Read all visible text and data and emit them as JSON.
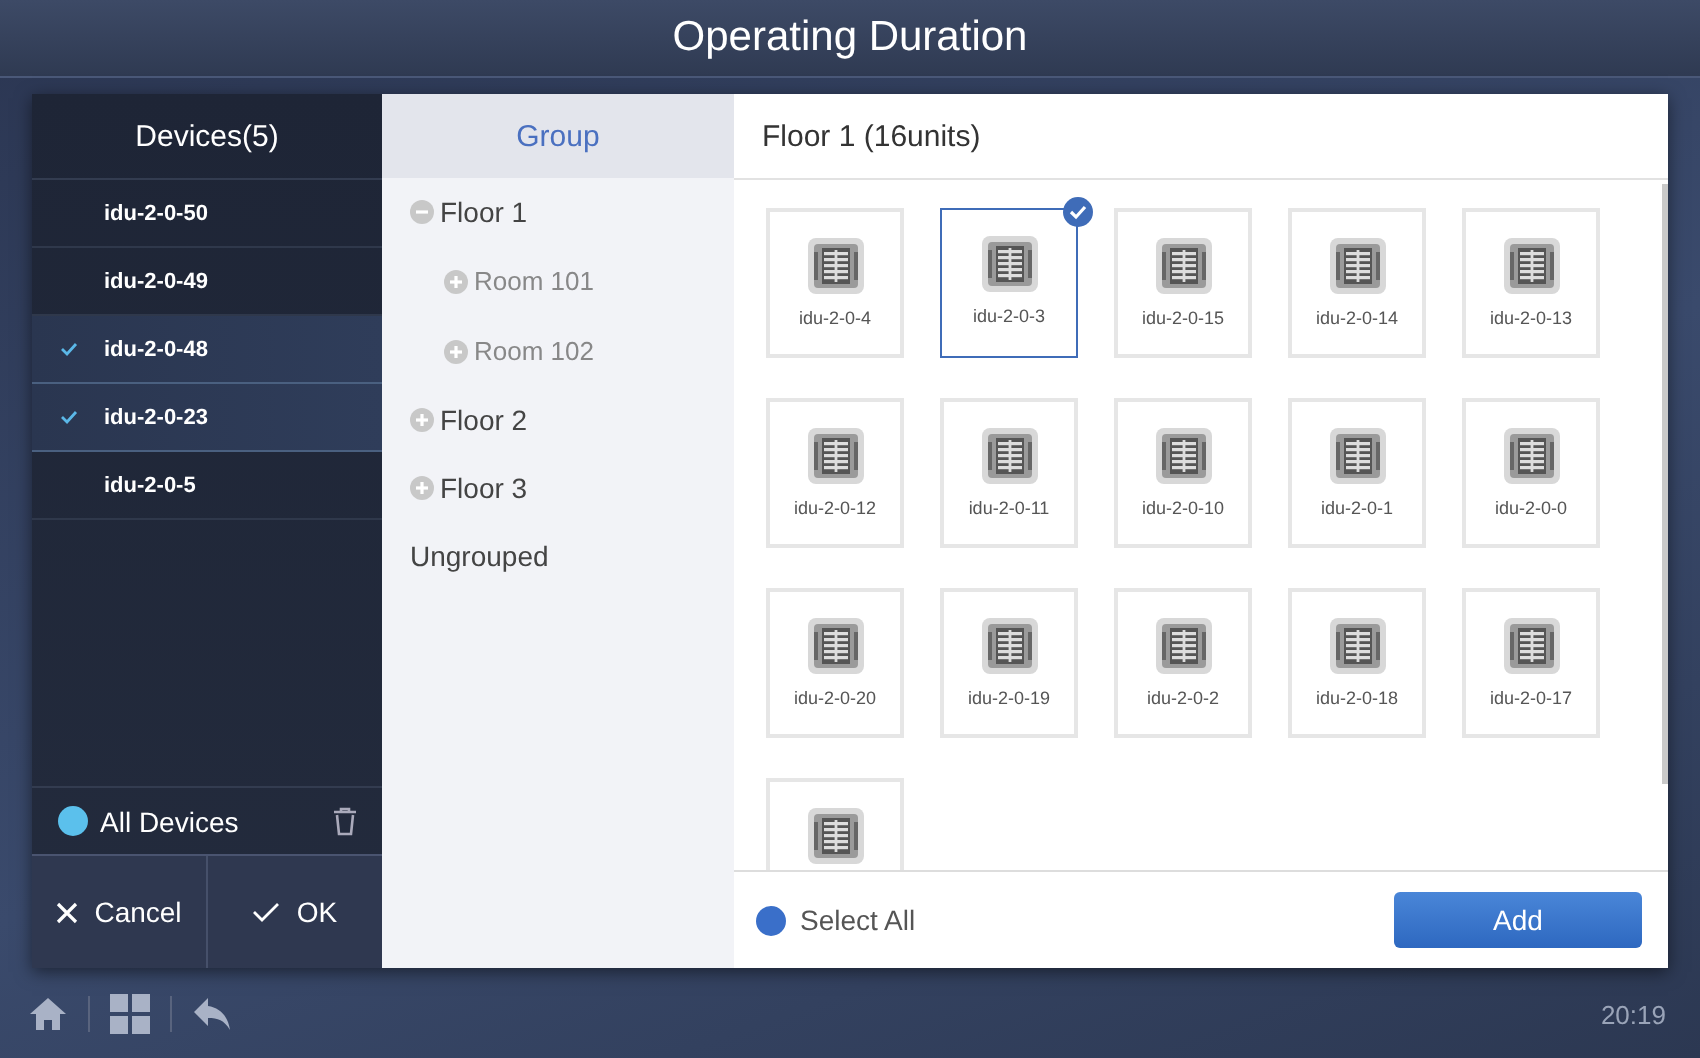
{
  "window": {
    "title": "Operating Duration"
  },
  "devices": {
    "title": "Devices(5)",
    "items": [
      {
        "name": "idu-2-0-50",
        "checked": false
      },
      {
        "name": "idu-2-0-49",
        "checked": false
      },
      {
        "name": "idu-2-0-48",
        "checked": true
      },
      {
        "name": "idu-2-0-23",
        "checked": true
      },
      {
        "name": "idu-2-0-5",
        "checked": false
      }
    ],
    "all_label": "All Devices",
    "buttons": [
      {
        "kind": "cancel",
        "label": "Cancel"
      },
      {
        "kind": "ok",
        "label": "OK"
      }
    ]
  },
  "groups": {
    "title": "Group",
    "tree": [
      {
        "kind": "group",
        "label": "Floor 1",
        "expanded": true,
        "children": [
          {
            "kind": "group",
            "label": "Room 101",
            "expanded": false
          },
          {
            "kind": "group",
            "label": "Room 102",
            "expanded": false
          }
        ]
      },
      {
        "kind": "group",
        "label": "Floor 2",
        "expanded": false
      },
      {
        "kind": "group",
        "label": "Floor 3",
        "expanded": false
      },
      {
        "kind": "plain",
        "label": "Ungrouped"
      }
    ]
  },
  "units": {
    "title": "Floor 1 (16units)",
    "tiles": [
      {
        "name": "idu-2-0-4",
        "selected": false
      },
      {
        "name": "idu-2-0-3",
        "selected": true
      },
      {
        "name": "idu-2-0-15",
        "selected": false
      },
      {
        "name": "idu-2-0-14",
        "selected": false
      },
      {
        "name": "idu-2-0-13",
        "selected": false
      },
      {
        "name": "idu-2-0-12",
        "selected": false
      },
      {
        "name": "idu-2-0-11",
        "selected": false
      },
      {
        "name": "idu-2-0-10",
        "selected": false
      },
      {
        "name": "idu-2-0-1",
        "selected": false
      },
      {
        "name": "idu-2-0-0",
        "selected": false
      },
      {
        "name": "idu-2-0-20",
        "selected": false
      },
      {
        "name": "idu-2-0-19",
        "selected": false
      },
      {
        "name": "idu-2-0-2",
        "selected": false
      },
      {
        "name": "idu-2-0-18",
        "selected": false
      },
      {
        "name": "idu-2-0-17",
        "selected": false
      },
      {
        "selected": false
      }
    ],
    "select_all": "Select All",
    "add_button": "Add"
  },
  "status_bar": {
    "time": "20:19"
  }
}
